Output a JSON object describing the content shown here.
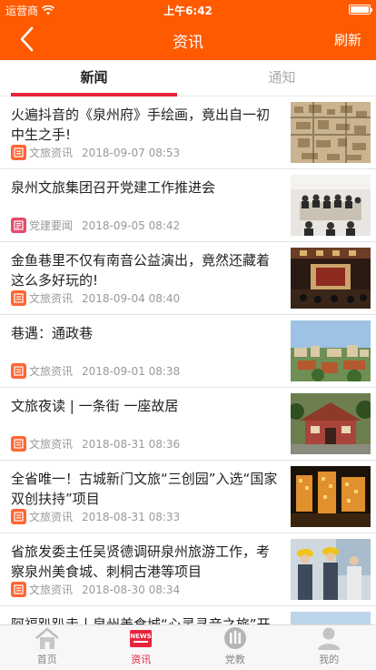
{
  "status_bar": {
    "carrier": "运营商",
    "time": "上午6:42",
    "battery_level": 1.0
  },
  "nav": {
    "title": "资讯",
    "refresh_label": "刷新",
    "back_icon": "chevron-left-icon"
  },
  "tabs": [
    {
      "label": "新闻",
      "active": true
    },
    {
      "label": "通知",
      "active": false
    }
  ],
  "colors": {
    "brand": "#ff5a00",
    "accent": "#e8243c",
    "culture_tag": "#ff6633",
    "party_tag": "#e84a6a"
  },
  "news": [
    {
      "title": "火遍抖音的《泉州府》手绘画，竟出自一初中生之手!",
      "category": "文旅资讯",
      "category_type": "culture",
      "date": "2018-09-07 08:53",
      "thumb": "painting"
    },
    {
      "title": "泉州文旅集团召开党建工作推进会",
      "category": "党建要闻",
      "category_type": "party",
      "date": "2018-09-05 08:42",
      "thumb": "meeting"
    },
    {
      "title": "金鱼巷里不仅有南音公益演出，竟然还藏着这么多好玩的!",
      "category": "文旅资讯",
      "category_type": "culture",
      "date": "2018-09-04 08:40",
      "thumb": "stage"
    },
    {
      "title": "巷遇：通政巷",
      "category": "文旅资讯",
      "category_type": "culture",
      "date": "2018-09-01 08:38",
      "thumb": "city"
    },
    {
      "title": "文旅夜读 | 一条街 一座故居",
      "category": "文旅资讯",
      "category_type": "culture",
      "date": "2018-08-31 08:36",
      "thumb": "house"
    },
    {
      "title": "全省唯一！古城新门文旅“三创园”入选“国家双创扶持”项目",
      "category": "文旅资讯",
      "category_type": "culture",
      "date": "2018-08-31 08:33",
      "thumb": "night"
    },
    {
      "title": "省旅发委主任吴贤德调研泉州旅游工作，考察泉州美食城、刺桐古港等项目",
      "category": "文旅资讯",
      "category_type": "culture",
      "date": "2018-08-30 08:34",
      "thumb": "visit"
    },
    {
      "title": "阿福趴趴走丨泉州美食城“心灵寻音之旅”开始报",
      "category": "",
      "category_type": "",
      "date": "",
      "thumb": "sky"
    }
  ],
  "bottom_tabs": [
    {
      "label": "首页",
      "icon": "home-icon",
      "active": false
    },
    {
      "label": "资讯",
      "icon": "news-icon",
      "active": true
    },
    {
      "label": "党教",
      "icon": "party-icon",
      "active": false
    },
    {
      "label": "我的",
      "icon": "user-icon",
      "active": false
    }
  ]
}
